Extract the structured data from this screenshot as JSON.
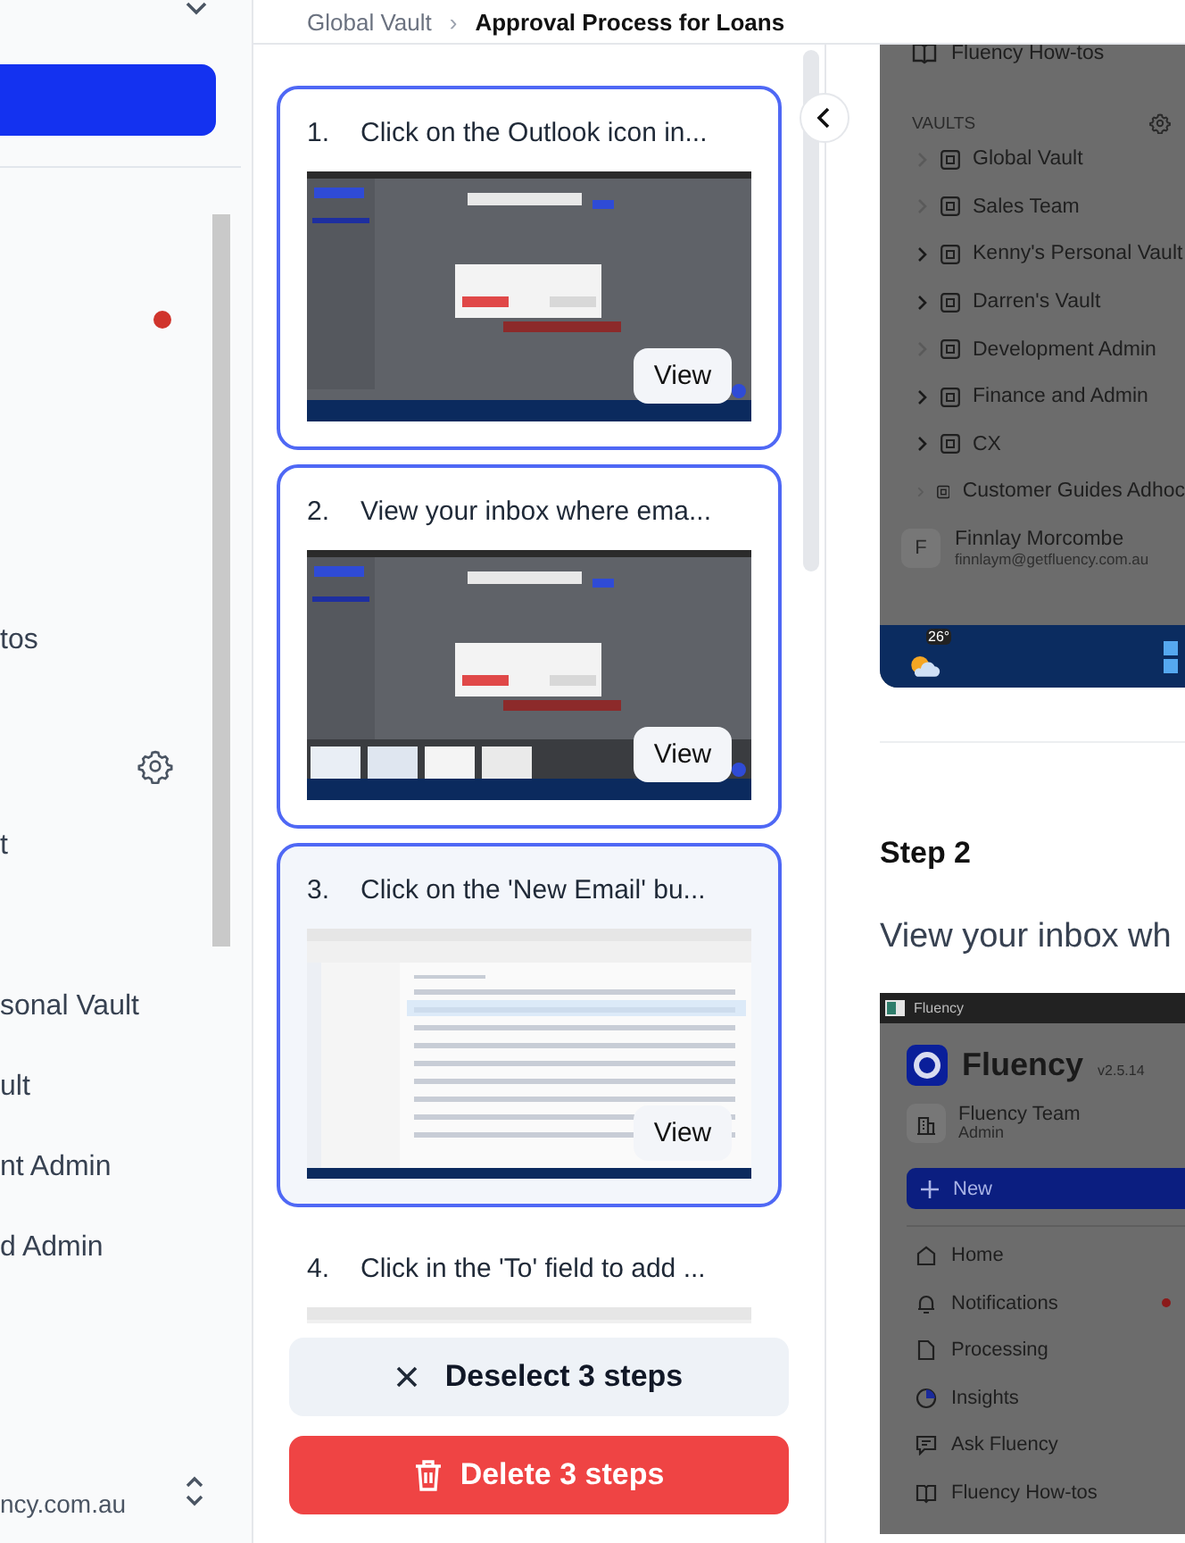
{
  "sidebar": {
    "howtos_label": "tos",
    "vault_items": [
      "t",
      "sonal Vault",
      "ult",
      "nt Admin",
      "d Admin"
    ],
    "account_email": "ncy.com.au"
  },
  "breadcrumb": {
    "parent": "Global Vault",
    "separator": "›",
    "current": "Approval Process for Loans"
  },
  "steps": [
    {
      "number": "1.",
      "text": "Click on the Outlook icon in...",
      "selected": true,
      "highlighted": false,
      "kind": "dialog",
      "view_button": "View"
    },
    {
      "number": "2.",
      "text": "View your inbox where ema...",
      "selected": true,
      "highlighted": false,
      "kind": "windows",
      "view_button": "View"
    },
    {
      "number": "3.",
      "text": "Click on the 'New Email' bu...",
      "selected": true,
      "highlighted": true,
      "kind": "mail",
      "view_button": "View"
    },
    {
      "number": "4.",
      "text": "Click in the 'To' field to add ...",
      "selected": false,
      "highlighted": false,
      "kind": "mail"
    }
  ],
  "actions": {
    "deselect_button": "Deselect 3 steps",
    "delete_button": "Delete 3 steps"
  },
  "preview": {
    "screenshot_1": {
      "howtos": "Fluency How-tos",
      "section": "VAULTS",
      "vaults": [
        {
          "label": "Global Vault",
          "expandable": false
        },
        {
          "label": "Sales Team",
          "expandable": false
        },
        {
          "label": "Kenny's Personal Vault",
          "expandable": true
        },
        {
          "label": "Darren's Vault",
          "expandable": true
        },
        {
          "label": "Development Admin",
          "expandable": false
        },
        {
          "label": "Finance and Admin",
          "expandable": true
        },
        {
          "label": "CX",
          "expandable": true
        },
        {
          "label": "Customer Guides Adhoc",
          "expandable": false
        }
      ],
      "avatar_initial": "F",
      "user_name": "Finnlay Morcombe",
      "user_email": "finnlaym@getfluency.com.au",
      "temperature": "26°"
    },
    "step_title": "Step 2",
    "step_text": "View your inbox wh",
    "screenshot_2": {
      "window_title": "Fluency",
      "app_name": "Fluency",
      "version": "v2.5.14",
      "team_name": "Fluency Team",
      "team_role": "Admin",
      "new_button": "New",
      "nav": [
        {
          "label": "Home",
          "kind": "home",
          "badge": false
        },
        {
          "label": "Notifications",
          "kind": "bell",
          "badge": true
        },
        {
          "label": "Processing",
          "kind": "file",
          "badge": false
        },
        {
          "label": "Insights",
          "kind": "pie",
          "badge": false
        },
        {
          "label": "Ask Fluency",
          "kind": "chat",
          "badge": false
        },
        {
          "label": "Fluency How-tos",
          "kind": "book",
          "badge": false
        }
      ]
    }
  }
}
